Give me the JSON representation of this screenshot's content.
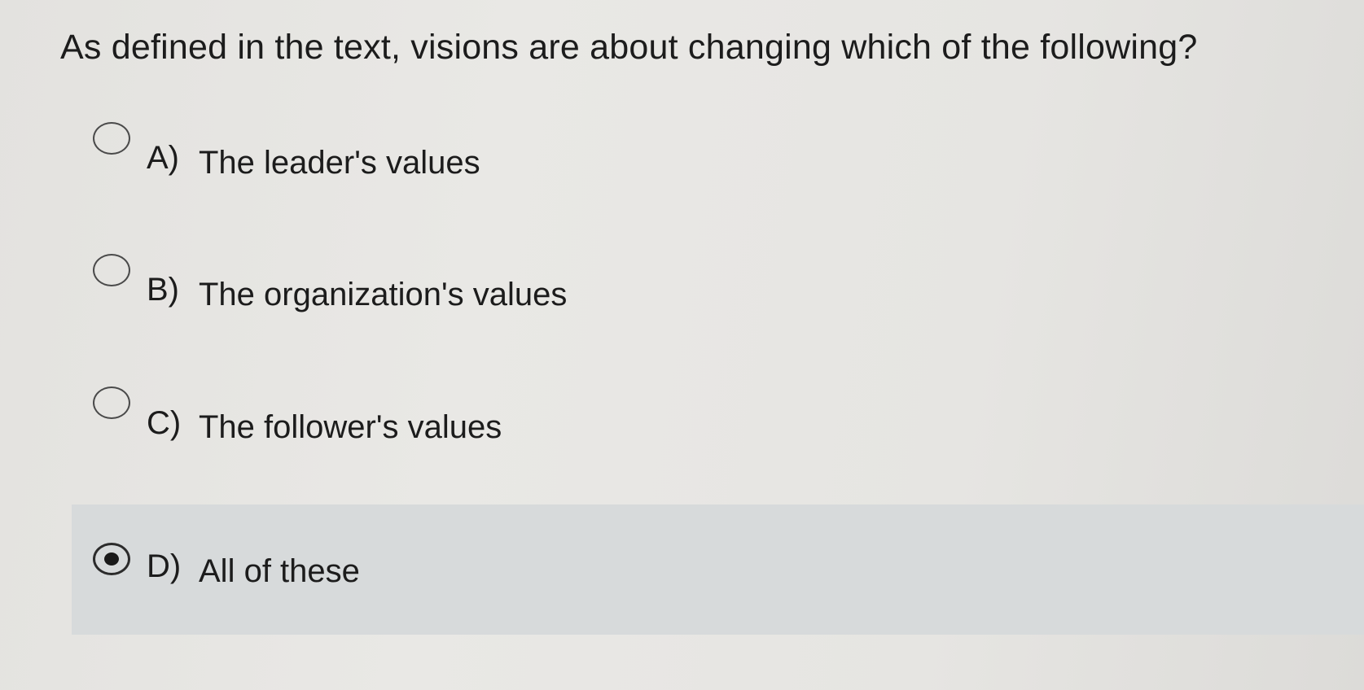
{
  "question": {
    "text": "As defined in the text, visions are about changing which of the following?"
  },
  "options": [
    {
      "letter": "A)",
      "text": "The leader's values",
      "selected": false
    },
    {
      "letter": "B)",
      "text": "The organization's values",
      "selected": false
    },
    {
      "letter": "C)",
      "text": "The follower's values",
      "selected": false
    },
    {
      "letter": "D)",
      "text": "All of these",
      "selected": true
    }
  ],
  "colors": {
    "background": "#e6e5e2",
    "selected_highlight": "#d7dadb",
    "text": "#1c1c1c"
  }
}
